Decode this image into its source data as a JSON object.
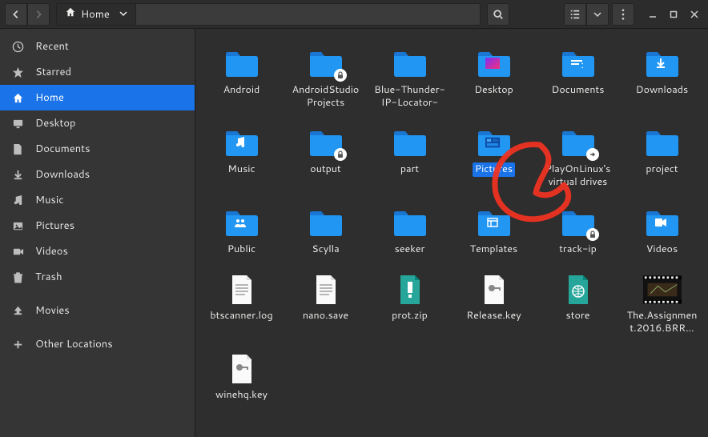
{
  "toolbar": {
    "path_label": "Home"
  },
  "sidebar": {
    "items": [
      {
        "label": "Recent",
        "icon": "clock"
      },
      {
        "label": "Starred",
        "icon": "star"
      },
      {
        "label": "Home",
        "icon": "home",
        "active": true
      },
      {
        "label": "Desktop",
        "icon": "desktop"
      },
      {
        "label": "Documents",
        "icon": "document"
      },
      {
        "label": "Downloads",
        "icon": "download"
      },
      {
        "label": "Music",
        "icon": "music"
      },
      {
        "label": "Pictures",
        "icon": "picture"
      },
      {
        "label": "Videos",
        "icon": "video"
      },
      {
        "label": "Trash",
        "icon": "trash"
      },
      {
        "label": "Movies",
        "icon": "eject"
      },
      {
        "label": "Other Locations",
        "icon": "plus"
      }
    ]
  },
  "content": {
    "items": [
      {
        "label": "Android",
        "type": "folder"
      },
      {
        "label": "AndroidStudioProjects",
        "type": "folder",
        "badge": "lock"
      },
      {
        "label": "Blue-Thunder-IP-Locator-",
        "type": "folder"
      },
      {
        "label": "Desktop",
        "type": "folder",
        "emblem": "desktop-gradient"
      },
      {
        "label": "Documents",
        "type": "folder",
        "emblem": "document"
      },
      {
        "label": "Downloads",
        "type": "folder",
        "emblem": "download"
      },
      {
        "label": "Music",
        "type": "folder",
        "emblem": "music"
      },
      {
        "label": "output",
        "type": "folder",
        "badge": "lock"
      },
      {
        "label": "part",
        "type": "folder"
      },
      {
        "label": "Pictures",
        "type": "folder",
        "emblem": "pictures-thumb",
        "selected": true
      },
      {
        "label": "PlayOnLinux's virtual drives",
        "type": "folder",
        "badge": "link"
      },
      {
        "label": "project",
        "type": "folder"
      },
      {
        "label": "Public",
        "type": "folder",
        "emblem": "public"
      },
      {
        "label": "Scylla",
        "type": "folder"
      },
      {
        "label": "seeker",
        "type": "folder"
      },
      {
        "label": "Templates",
        "type": "folder",
        "emblem": "templates"
      },
      {
        "label": "track-ip",
        "type": "folder",
        "badge": "lock"
      },
      {
        "label": "Videos",
        "type": "folder",
        "emblem": "videos"
      },
      {
        "label": "btscanner.log",
        "type": "file-text"
      },
      {
        "label": "nano.save",
        "type": "file-text"
      },
      {
        "label": "prot.zip",
        "type": "file-zip"
      },
      {
        "label": "Release.key",
        "type": "file-key"
      },
      {
        "label": "store",
        "type": "file-web"
      },
      {
        "label": "The.Assignment.2016.BRR…",
        "type": "file-video"
      },
      {
        "label": "winehq.key",
        "type": "file-key"
      }
    ]
  },
  "colors": {
    "accent": "#1a73e8",
    "folder": "#2196f3",
    "annotation": "#e32222"
  }
}
